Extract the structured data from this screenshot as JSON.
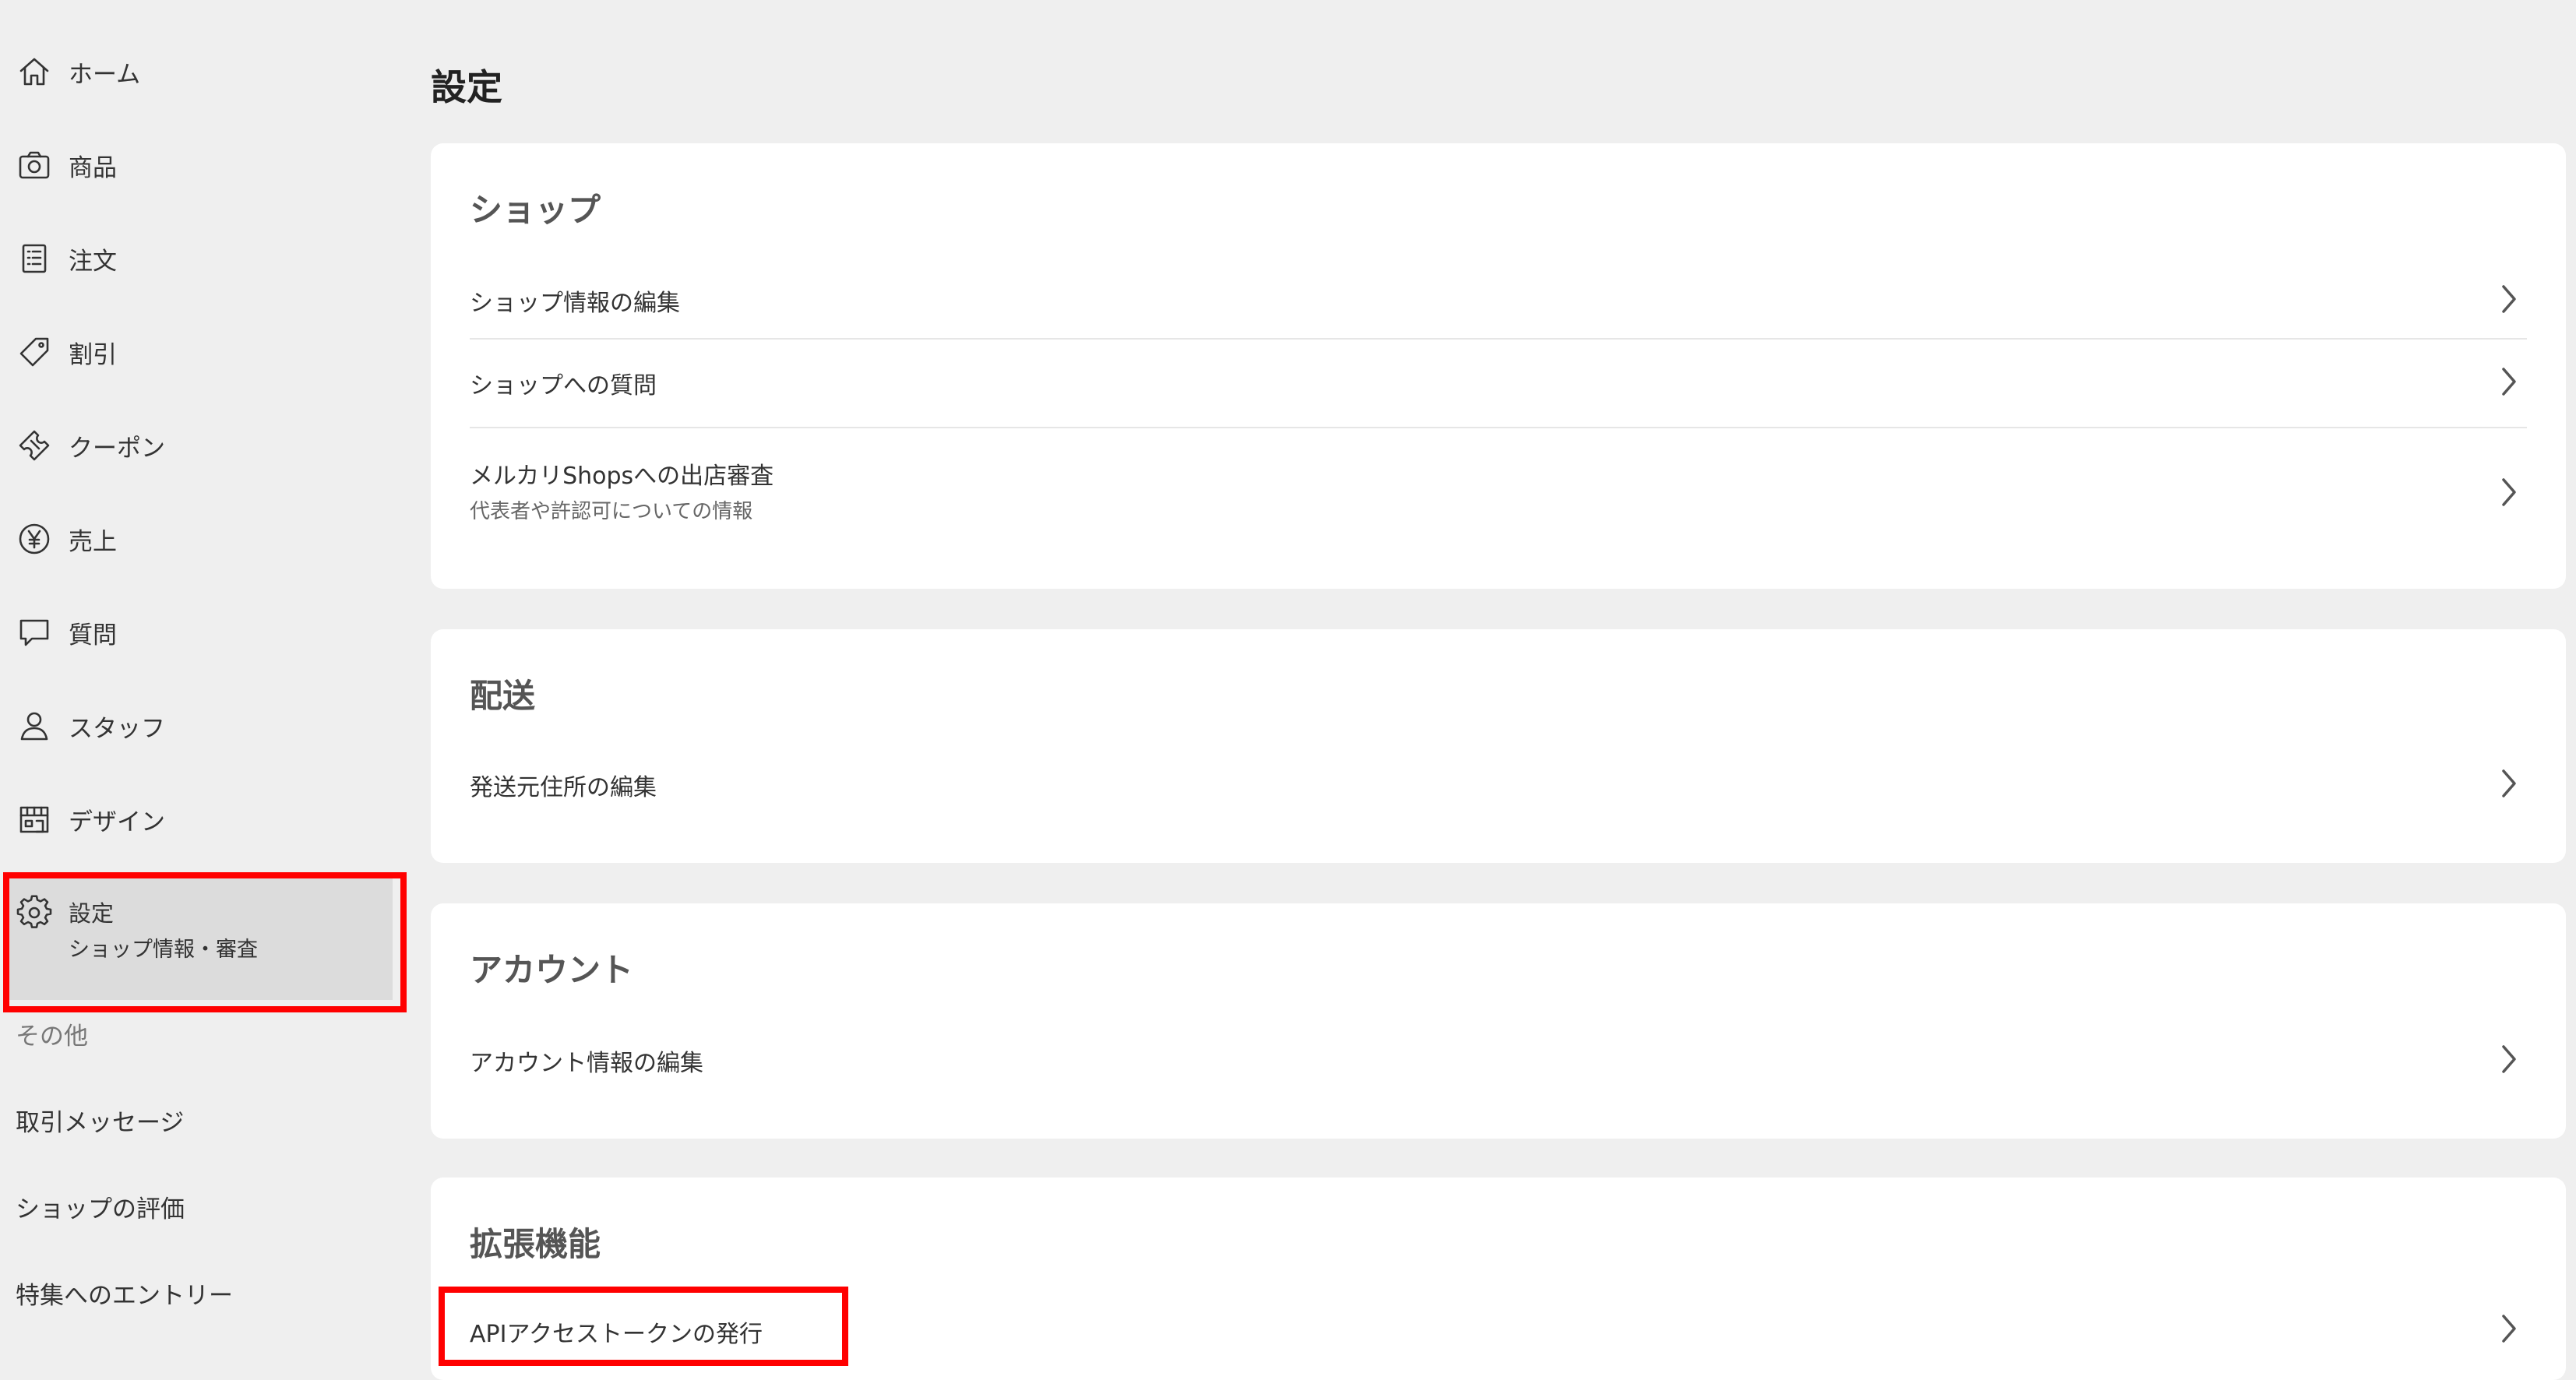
{
  "sidebar": {
    "items": [
      {
        "label": "ホーム",
        "icon": "home-icon"
      },
      {
        "label": "商品",
        "icon": "camera-icon"
      },
      {
        "label": "注文",
        "icon": "order-list-icon"
      },
      {
        "label": "割引",
        "icon": "tag-icon"
      },
      {
        "label": "クーポン",
        "icon": "ticket-icon"
      },
      {
        "label": "売上",
        "icon": "yen-icon"
      },
      {
        "label": "質問",
        "icon": "chat-icon"
      },
      {
        "label": "スタッフ",
        "icon": "person-icon"
      },
      {
        "label": "デザイン",
        "icon": "storefront-icon"
      }
    ],
    "settings": {
      "label": "設定",
      "sublabel": "ショップ情報・審査",
      "icon": "gear-icon"
    },
    "other_heading": "その他",
    "other_links": [
      "取引メッセージ",
      "ショップの評価",
      "特集へのエントリー"
    ]
  },
  "main": {
    "title": "設定",
    "sections": [
      {
        "title": "ショップ",
        "rows": [
          {
            "label": "ショップ情報の編集"
          },
          {
            "label": "ショップへの質問"
          },
          {
            "label": "メルカリShopsへの出店審査",
            "sublabel": "代表者や許認可についての情報"
          }
        ]
      },
      {
        "title": "配送",
        "rows": [
          {
            "label": "発送元住所の編集"
          }
        ]
      },
      {
        "title": "アカウント",
        "rows": [
          {
            "label": "アカウント情報の編集"
          }
        ]
      },
      {
        "title": "拡張機能",
        "rows": [
          {
            "label": "APIアクセストークンの発行"
          }
        ]
      }
    ]
  },
  "colors": {
    "background": "#efefef",
    "card": "#ffffff",
    "highlight_box": "#ff0000",
    "selected_nav": "#dcdcdc"
  }
}
